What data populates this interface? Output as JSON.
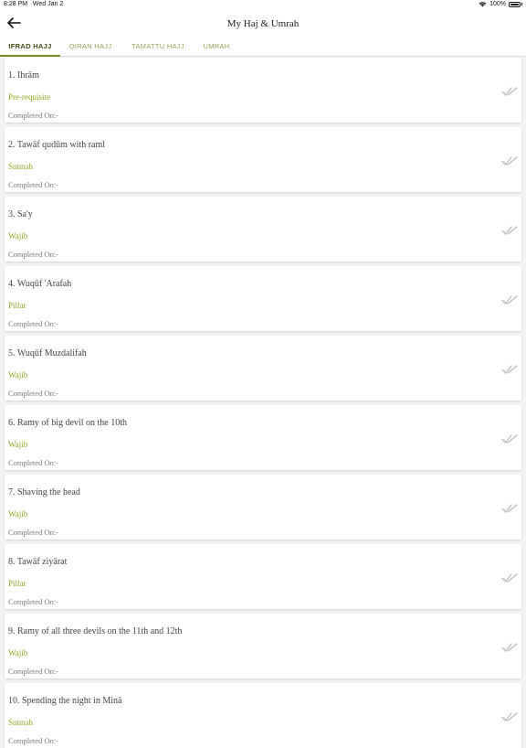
{
  "status_bar": {
    "time": "8:28 PM",
    "date": "Wed Jan 2",
    "battery": "100%",
    "wifi_icon": "wifi-icon",
    "battery_icon": "battery-icon"
  },
  "header": {
    "title": "My Haj & Umrah",
    "back_icon": "arrow-left-icon"
  },
  "tabs": [
    {
      "label": "IFRAD HAJJ",
      "active": true
    },
    {
      "label": "QIRAN HAJJ",
      "active": false
    },
    {
      "label": "TAMATTU HAJJ",
      "active": false
    },
    {
      "label": "UMRAH",
      "active": false
    }
  ],
  "colors": {
    "accent": "#7b8a2a",
    "category": "#8aaa22",
    "tab_inactive": "#9aa05a"
  },
  "steps": [
    {
      "title": "1. Ihrām",
      "category": "Pre-requisite",
      "completed": "Completed On:-"
    },
    {
      "title": "2. Tawāf qudūm with raml",
      "category": "Sunnah",
      "completed": "Completed On:-"
    },
    {
      "title": "3. Sa'y",
      "category": "Wajib",
      "completed": "Completed On:-"
    },
    {
      "title": "4. Wuqūf 'Arafah",
      "category": "Pillar",
      "completed": "Completed On:-"
    },
    {
      "title": "5. Wuqūf Muzdalifah",
      "category": "Wajib",
      "completed": "Completed On:-"
    },
    {
      "title": "6. Ramy of big devil on the 10th",
      "category": "Wajib",
      "completed": "Completed On:-"
    },
    {
      "title": "7. Shaving the head",
      "category": "Wajib",
      "completed": "Completed On:-"
    },
    {
      "title": "8. Tawāf ziyārat",
      "category": "Pillar",
      "completed": "Completed On:-"
    },
    {
      "title": "9. Ramy of all three devils  on the 11th and 12th",
      "category": "Wajib",
      "completed": "Completed On:-"
    },
    {
      "title": "10. Spending the night in Minā",
      "category": "Sunnah",
      "completed": "Completed On:-"
    }
  ]
}
